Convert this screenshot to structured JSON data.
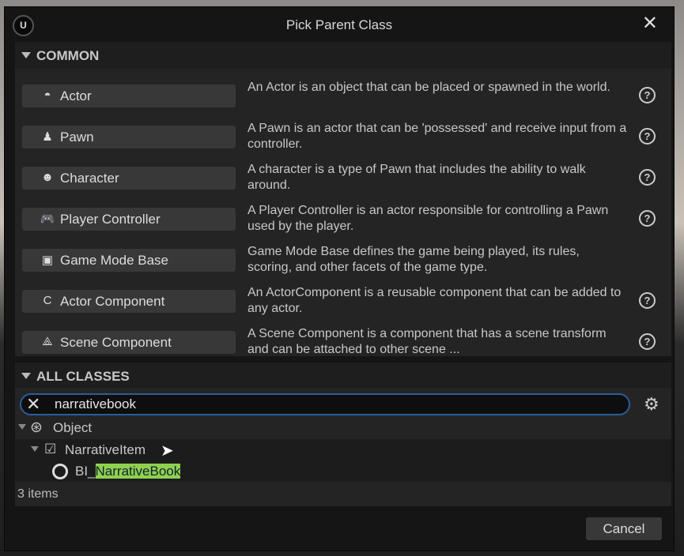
{
  "dialog": {
    "title": "Pick Parent Class",
    "close_icon": "close-icon",
    "logo": "unreal-logo"
  },
  "common": {
    "header": "COMMON",
    "items": [
      {
        "label": "Actor",
        "icon": "actor-icon",
        "glyph": "◓",
        "description": "An Actor is an object that can be placed or spawned in the world.",
        "help": true
      },
      {
        "label": "Pawn",
        "icon": "pawn-icon",
        "glyph": "♟",
        "description": "A Pawn is an actor that can be 'possessed' and receive input from a controller.",
        "help": true
      },
      {
        "label": "Character",
        "icon": "character-icon",
        "glyph": "☻",
        "description": "A character is a type of Pawn that includes the ability to walk around.",
        "help": true
      },
      {
        "label": "Player Controller",
        "icon": "gamepad-icon",
        "glyph": "🎮",
        "description": "A Player Controller is an actor responsible for controlling a Pawn used by the player.",
        "help": true
      },
      {
        "label": "Game Mode Base",
        "icon": "game-mode-icon",
        "glyph": "▣",
        "description": "Game Mode Base defines the game being played, its rules, scoring, and other facets of the game type.",
        "help": false
      },
      {
        "label": "Actor Component",
        "icon": "component-icon",
        "glyph": "C",
        "description": "An ActorComponent is a reusable component that can be added to any actor.",
        "help": true
      },
      {
        "label": "Scene Component",
        "icon": "scene-component-icon",
        "glyph": "⟁",
        "description": "A Scene Component is a component that has a scene transform and can be attached to other scene ...",
        "help": true
      }
    ]
  },
  "all_classes": {
    "header": "ALL CLASSES",
    "search_value": "narrativebook",
    "tree": [
      {
        "label": "Object"
      },
      {
        "label": "NarrativeItem"
      },
      {
        "prefix": "BI_",
        "match": "NarrativeBook"
      }
    ],
    "count": "3 items"
  },
  "footer": {
    "cancel": "Cancel"
  },
  "colors": {
    "accent": "#2a5d9a",
    "highlight": "#8fd14f"
  }
}
